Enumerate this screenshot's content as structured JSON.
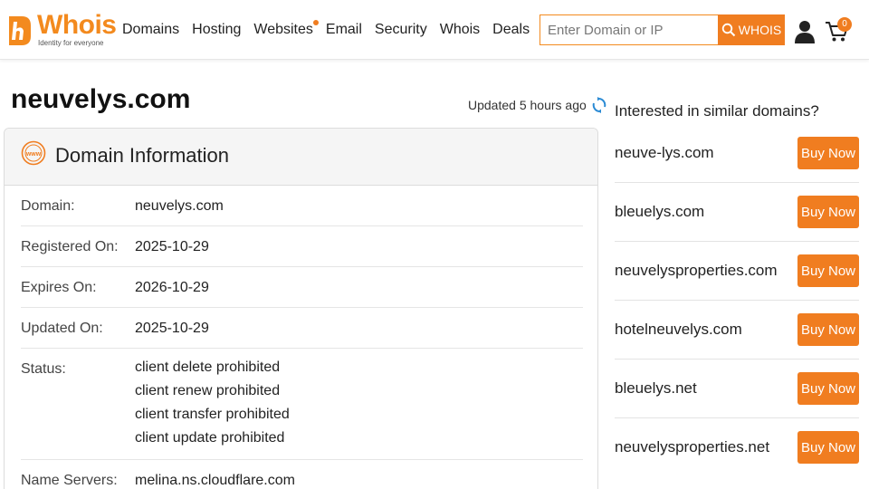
{
  "header": {
    "logo": {
      "word": "Whois",
      "tagline": "Identity for everyone"
    },
    "nav": [
      "Domains",
      "Hosting",
      "Websites",
      "Email",
      "Security",
      "Whois",
      "Deals"
    ],
    "search": {
      "placeholder": "Enter Domain or IP",
      "value": "",
      "button_label": "WHOIS"
    },
    "cart_count": "0"
  },
  "main": {
    "domain": "neuvelys.com",
    "updated_text": "Updated 5 hours ago",
    "card_title": "Domain Information",
    "rows": [
      {
        "label": "Domain:",
        "value": "neuvelys.com"
      },
      {
        "label": "Registered On:",
        "value": "2025-10-29"
      },
      {
        "label": "Expires On:",
        "value": "2026-10-29"
      },
      {
        "label": "Updated On:",
        "value": "2025-10-29"
      },
      {
        "label": "Status:",
        "values": [
          "client delete prohibited",
          "client renew prohibited",
          "client transfer prohibited",
          "client update prohibited"
        ]
      },
      {
        "label": "Name Servers:",
        "value": "melina.ns.cloudflare.com"
      }
    ]
  },
  "similar": {
    "heading": "Interested in similar domains?",
    "button_label": "Buy Now",
    "domains": [
      "neuve-lys.com",
      "bleuelys.com",
      "neuvelysproperties.com",
      "hotelneuvelys.com",
      "bleuelys.net",
      "neuvelysproperties.net"
    ]
  },
  "colors": {
    "accent": "#f07d20",
    "logo": "#f38a1e",
    "refresh": "#2a8ad4"
  }
}
